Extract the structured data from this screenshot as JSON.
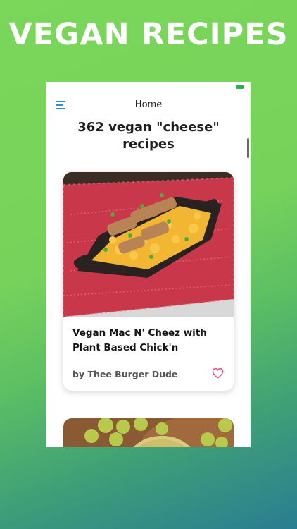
{
  "promo": {
    "title": "VEGAN RECIPES"
  },
  "header": {
    "title": "Home"
  },
  "results": {
    "title": "362 vegan \"cheese\" recipes"
  },
  "cards": [
    {
      "title": "Vegan Mac N' Cheez with Plant Based Chick'n",
      "author": "by Thee Burger Dude",
      "image": "mac-and-cheese-photo"
    },
    {
      "image": "cheese-ball-with-grapes-photo"
    }
  ],
  "icons": {
    "menu": "hamburger-menu-icon",
    "favorite": "heart-outline-icon",
    "battery": "battery-icon"
  },
  "colors": {
    "accent": "#2b8fd6",
    "heart": "#d24f7f",
    "background_top": "#7ad75a",
    "background_bottom": "#2a7d92"
  }
}
